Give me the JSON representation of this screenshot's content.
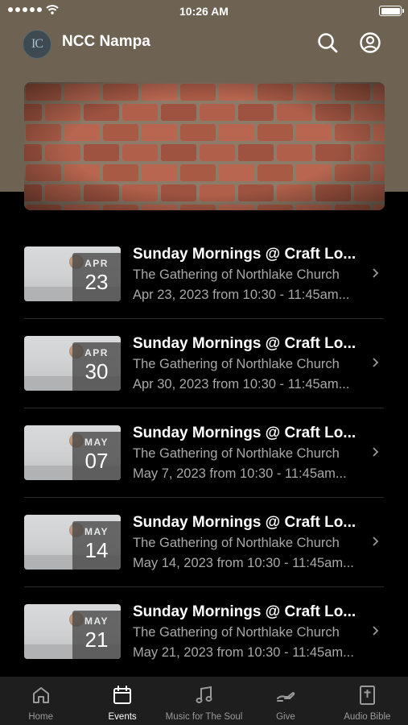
{
  "status_bar": {
    "time": "10:26 AM"
  },
  "header": {
    "app_title": "NCC Nampa",
    "logo_text": "IC",
    "search_icon": "search-icon",
    "profile_icon": "profile-icon"
  },
  "events": [
    {
      "title": "Sunday Mornings @ Craft Lo...",
      "subtitle": "The Gathering of Northlake Church",
      "date_text": "Apr 23, 2023 from 10:30 - 11:45am...",
      "month": "APR",
      "day": "23"
    },
    {
      "title": "Sunday Mornings @ Craft Lo...",
      "subtitle": "The Gathering of Northlake Church",
      "date_text": "Apr 30, 2023 from 10:30 - 11:45am...",
      "month": "APR",
      "day": "30"
    },
    {
      "title": "Sunday Mornings @ Craft Lo...",
      "subtitle": "The Gathering of Northlake Church",
      "date_text": "May 7, 2023 from 10:30 - 11:45am...",
      "month": "MAY",
      "day": "07"
    },
    {
      "title": "Sunday Mornings @ Craft Lo...",
      "subtitle": "The Gathering of Northlake Church",
      "date_text": "May 14, 2023 from 10:30 - 11:45am...",
      "month": "MAY",
      "day": "14"
    },
    {
      "title": "Sunday Mornings @ Craft Lo...",
      "subtitle": "The Gathering of Northlake Church",
      "date_text": "May 21, 2023 from 10:30 - 11:45am...",
      "month": "MAY",
      "day": "21"
    }
  ],
  "tabs": [
    {
      "label": "Home",
      "icon": "home-icon",
      "active": false
    },
    {
      "label": "Events",
      "icon": "calendar-icon",
      "active": true
    },
    {
      "label": "Music for The Soul",
      "icon": "music-note-icon",
      "active": false
    },
    {
      "label": "Give",
      "icon": "give-hand-icon",
      "active": false
    },
    {
      "label": "Audio Bible",
      "icon": "bible-icon",
      "active": false
    }
  ],
  "colors": {
    "header_bg": "#6e6253",
    "page_bg": "#000000",
    "tab_bar_bg": "#1e1e1e",
    "secondary_text": "#a8a8a8"
  }
}
